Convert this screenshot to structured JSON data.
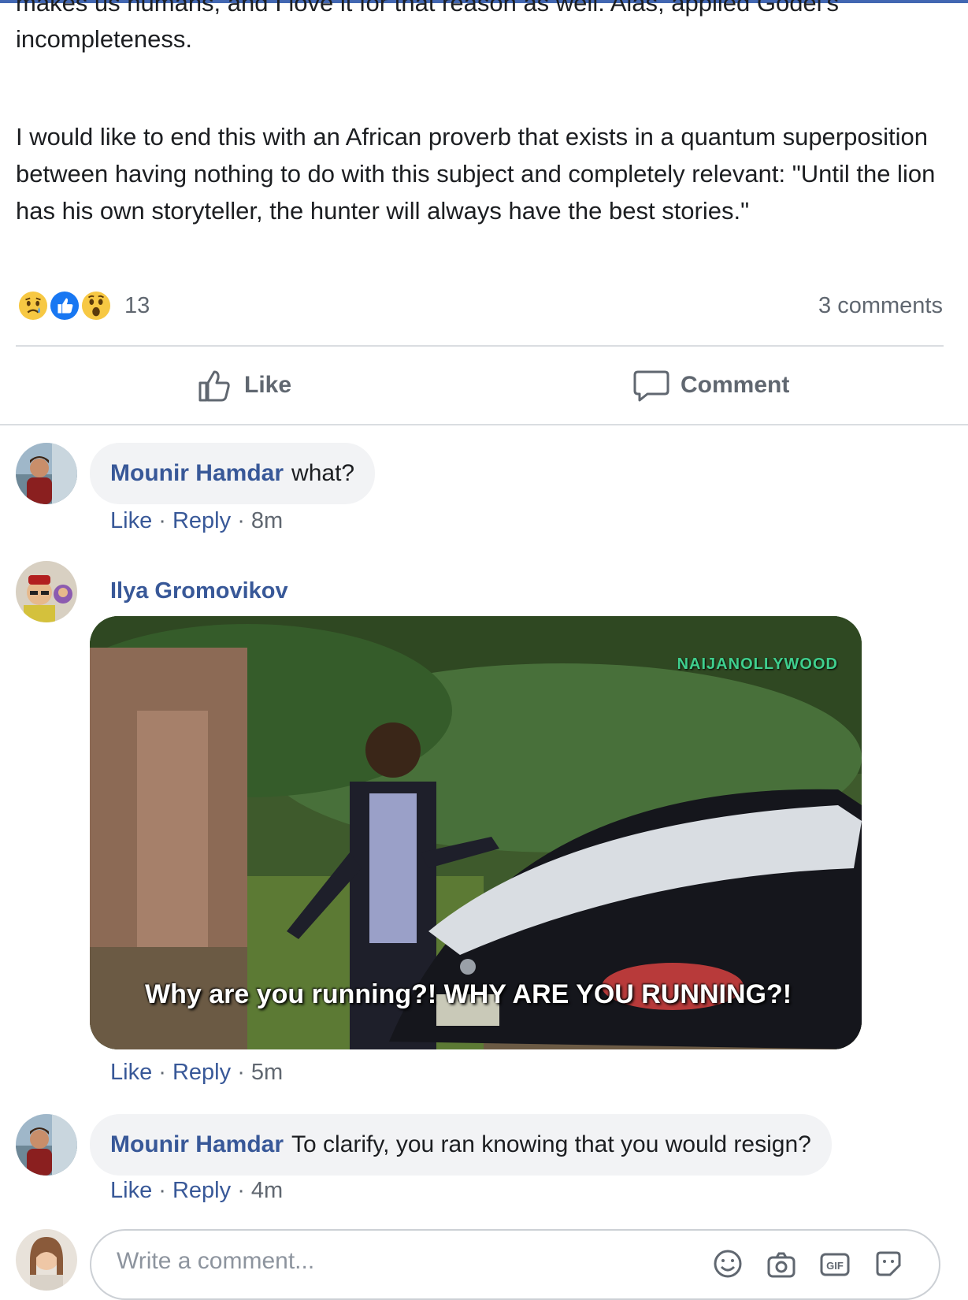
{
  "post": {
    "cut_line": "makes us humans, and I love it for that reason as well. Alas, applied Godel's",
    "incompleteness": "incompleteness.",
    "proverb": "I would like to end this with an African proverb that exists in a quantum superposition between having nothing to do with this subject and completely relevant: \"Until the lion has his own storyteller, the hunter will always have the best stories.\""
  },
  "reactions": {
    "icons": [
      "sad-icon",
      "like-icon",
      "wow-icon"
    ],
    "count": "13",
    "comments_count": "3 comments"
  },
  "actions": {
    "like_label": "Like",
    "comment_label": "Comment"
  },
  "comments": [
    {
      "author": "Mounir Hamdar",
      "text": "what?",
      "like": "Like",
      "reply": "Reply",
      "time": "8m"
    },
    {
      "author": "Ilya Gromovikov",
      "gif_caption": "Why are you running?! WHY ARE YOU RUNNING?!",
      "gif_logo": "NAIJANOLLYWOOD",
      "like": "Like",
      "reply": "Reply",
      "time": "5m"
    },
    {
      "author": "Mounir Hamdar",
      "text": "To clarify, you ran knowing that you would resign?",
      "like": "Like",
      "reply": "Reply",
      "time": "4m"
    }
  ],
  "composer": {
    "placeholder": "Write a comment...",
    "icons": [
      "emoji-icon",
      "camera-icon",
      "gif-icon",
      "sticker-icon"
    ]
  },
  "colors": {
    "brand": "#4267b2",
    "link": "#385898",
    "muted": "#606770",
    "bubble": "#f2f3f5"
  }
}
